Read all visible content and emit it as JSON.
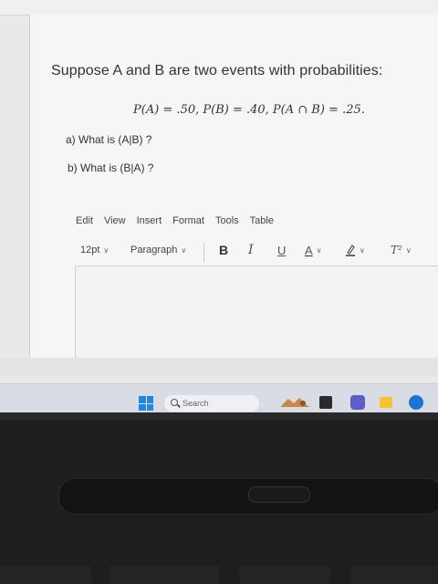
{
  "question": {
    "text": "Suppose A and B are two events with probabilities:",
    "formula": "P(A) = .50,  P(B) = .40,  P(A ∩ B) = .25.",
    "part_a": "a) What is (A|B) ?",
    "part_b": "b) What is (B|A) ?"
  },
  "editor": {
    "menu": [
      "Edit",
      "View",
      "Insert",
      "Format",
      "Tools",
      "Table"
    ],
    "font_size": "12pt",
    "block_format": "Paragraph",
    "bold": "B",
    "italic": "I",
    "underline": "U",
    "text_color": "A",
    "superscript": "T²"
  },
  "taskbar": {
    "search_label": "Search",
    "icons": [
      "windows-start-icon",
      "search-icon",
      "widget-icon",
      "file-explorer-icon",
      "teams-icon",
      "folder-icon",
      "edge-icon"
    ]
  },
  "colors": {
    "windows_blue": "#1e88e5",
    "edge_blue": "#1976d2",
    "folder_yellow": "#f4c430",
    "teams_purple": "#5b5fc7"
  }
}
